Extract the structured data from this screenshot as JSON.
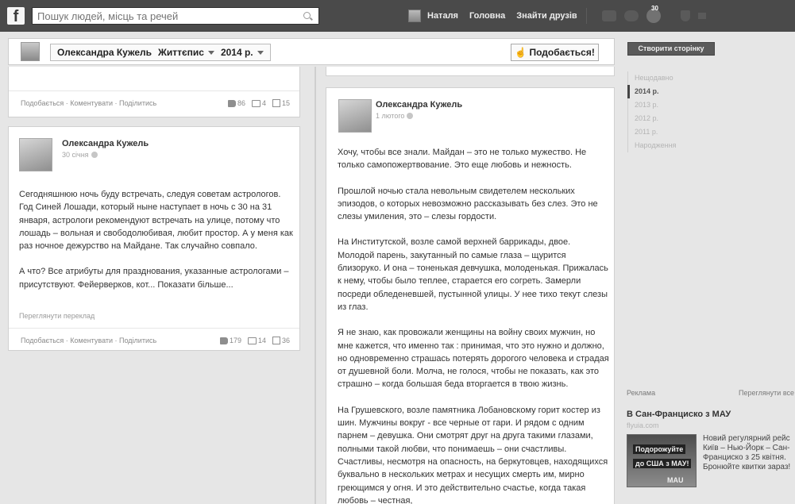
{
  "topbar": {
    "logo": "f",
    "search_placeholder": "Пошук людей, місць та речей",
    "nav_links": [
      "Наталя",
      "Головна",
      "Знайти друзів"
    ],
    "notifications_count": "30"
  },
  "timeline_bar": {
    "page_name": "Олександра Кужель",
    "section": "Життєпис",
    "year": "2014 р.",
    "like_button": "Подобається!"
  },
  "sidebar": {
    "create_page": "Створити сторінку",
    "years": [
      "Нещодавно",
      "2014 р.",
      "2013 р.",
      "2012 р.",
      "2011 р.",
      "Народження"
    ]
  },
  "posts": [
    {
      "actions": "Подобається · Коментувати · Поділитись",
      "likes": "86",
      "comments": "4",
      "shares": "15"
    },
    {
      "author": "Олександра Кужель",
      "date": "30 січня",
      "paragraphs": [
        "Сегодняшнюю ночь буду встречать, следуя советам астрологов. Год Синей Лошади, который ныне наступает в ночь с 30 на 31 января, астрологи рекомендуют встречать на улице, потому что лошадь – вольная и свободолюбивая, любит простор. А у меня как раз ночное дежурство на Майдане. Так случайно совпало.",
        "А что? Все атрибуты для празднования, указанные астрологами – присутствуют. Фейерверков, кот... Показати більше..."
      ],
      "see_translation": "Переглянути переклад",
      "actions": "Подобається · Коментувати · Поділитись",
      "likes": "179",
      "comments": "14",
      "shares": "36"
    },
    {
      "author": "Олександра Кужель",
      "date": "1 лютого",
      "paragraphs": [
        "Хочу, чтобы все знали. Майдан – это не только мужество. Не только самопожертвование. Это еще любовь и нежность.",
        "Прошлой ночью стала невольным свидетелем нескольких эпизодов, о которых невозможно рассказывать без слез. Это не слезы умиления, это – слезы гордости.",
        "На Институтской, возле самой верхней баррикады, двое. Молодой парень, закутанный по самые глаза – щурится близоруко. И она – тоненькая девчушка, молоденькая. Прижалась к нему, чтобы было теплее, старается его согреть. Замерли посреди обледеневшей, пустынной улицы. У нее тихо текут слезы из глаз.",
        "Я не знаю, как провожали женщины на войну своих мужчин, но мне кажется, что именно так : принимая, что это нужно и должно, но одновременно страшась потерять дорогого человека и страдая от душевной боли. Молча, не голося, чтобы не показать, как это страшно – когда большая беда вторгается в твою жизнь.",
        "На Грушевского, возле памятника Лобановскому горит костер из шин. Мужчины вокруг - все черные от гари. И рядом с одним парнем – девушка. Они смотрят друг на друга такими глазами, полными такой любви, что понимаешь – они счастливы. Счастливы, несмотря на опасность, на беркутовцев, находящихся буквально в нескольких метрах и несущих смерть им, мирно греющимся у огня. И это действительно счастье, когда такая любовь – честная,"
      ]
    }
  ],
  "ad": {
    "label": "Реклама",
    "view_all": "Переглянути все",
    "title": "В Сан-Франциско з МАУ",
    "domain": "flyuia.com",
    "image_button_1": "Подорожуйте",
    "image_button_2": "до США з МАУ!",
    "image_brand": "MAU",
    "text": "Новий регулярний рейс Київ – Нью-Йорк – Сан-Франциско з 25 квітня. Бронюйте квитки зараз!"
  }
}
